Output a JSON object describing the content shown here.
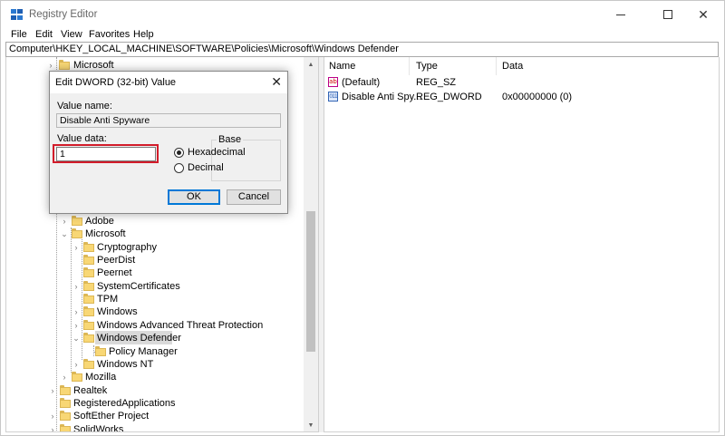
{
  "window": {
    "title": "Registry Editor",
    "close_glyph": "✕"
  },
  "menu": [
    "File",
    "Edit",
    "View",
    "Favorites",
    "Help"
  ],
  "address": "Computer\\HKEY_LOCAL_MACHINE\\SOFTWARE\\Policies\\Microsoft\\Windows Defender",
  "tree": {
    "items": [
      {
        "label": "Microsoft",
        "chevron": "›"
      },
      {
        "label": "Adobe",
        "chevron": "›"
      },
      {
        "label": "Microsoft",
        "chevron": "⌄"
      },
      {
        "label": "Cryptography",
        "chevron": "›"
      },
      {
        "label": "PeerDist",
        "chevron": ""
      },
      {
        "label": "Peernet",
        "chevron": ""
      },
      {
        "label": "SystemCertificates",
        "chevron": "›"
      },
      {
        "label": "TPM",
        "chevron": ""
      },
      {
        "label": "Windows",
        "chevron": "›"
      },
      {
        "label": "Windows Advanced Threat Protection",
        "chevron": "›"
      },
      {
        "label": "Windows Defender",
        "chevron": "⌄"
      },
      {
        "label": "Policy Manager",
        "chevron": ""
      },
      {
        "label": "Windows NT",
        "chevron": "›"
      },
      {
        "label": "Mozilla",
        "chevron": "›"
      },
      {
        "label": "Realtek",
        "chevron": "›"
      },
      {
        "label": "RegisteredApplications",
        "chevron": ""
      },
      {
        "label": "SoftEther Project",
        "chevron": "›"
      },
      {
        "label": "SolidWorks",
        "chevron": "›"
      }
    ]
  },
  "list": {
    "columns": [
      "Name",
      "Type",
      "Data"
    ],
    "rows": [
      {
        "name": "(Default)",
        "type": "REG_SZ",
        "data": "",
        "icon": "string-value-icon",
        "icon_text": "ab"
      },
      {
        "name": "Disable Anti Spy...",
        "type": "REG_DWORD",
        "data": "0x00000000 (0)",
        "icon": "binary-value-icon",
        "icon_text": "011"
      }
    ]
  },
  "dialog": {
    "title": "Edit DWORD (32-bit) Value",
    "close_glyph": "✕",
    "value_name_label": "Value name:",
    "value_name": "Disable Anti Spyware",
    "value_data_label": "Value data:",
    "value_data": "1",
    "base_label": "Base",
    "radio_hex": "Hexadecimal",
    "radio_dec": "Decimal",
    "selected_base": "Hexadecimal",
    "ok_label": "OK",
    "cancel_label": "Cancel",
    "highlight_color": "#d21c2a"
  },
  "scroll_glyphs": {
    "up": "▲",
    "down": "▼"
  }
}
